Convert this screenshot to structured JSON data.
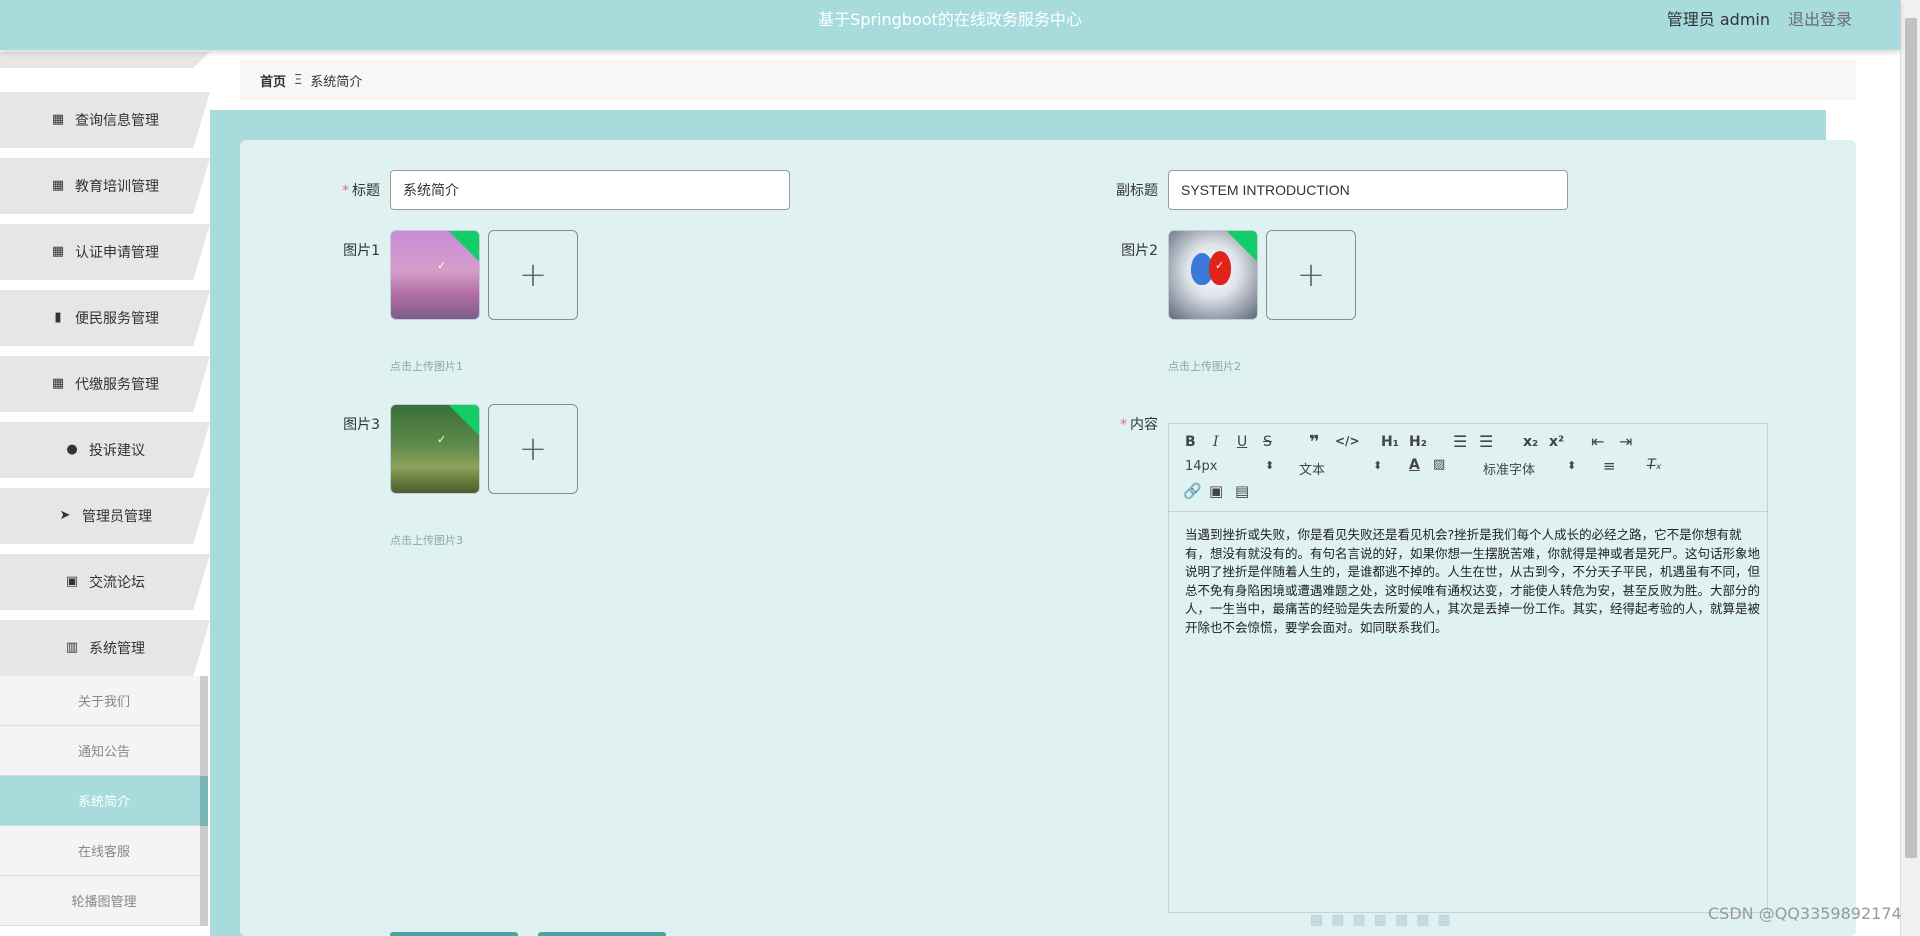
{
  "header": {
    "title": "基于Springboot的在线政务服务中心",
    "user_label": "管理员 admin",
    "logout_label": "退出登录"
  },
  "sidebar": {
    "items": [
      {
        "label": "查询信息管理",
        "icon": "grid-icon"
      },
      {
        "label": "教育培训管理",
        "icon": "grid-icon"
      },
      {
        "label": "认证申请管理",
        "icon": "grid-icon"
      },
      {
        "label": "便民服务管理",
        "icon": "bar-chart-icon"
      },
      {
        "label": "代缴服务管理",
        "icon": "grid-icon"
      },
      {
        "label": "投诉建议",
        "icon": "user-icon"
      },
      {
        "label": "管理员管理",
        "icon": "send-icon"
      },
      {
        "label": "交流论坛",
        "icon": "clipboard-icon"
      },
      {
        "label": "系统管理",
        "icon": "book-icon"
      }
    ],
    "sub_items": [
      {
        "label": "关于我们"
      },
      {
        "label": "通知公告"
      },
      {
        "label": "系统简介"
      },
      {
        "label": "在线客服"
      },
      {
        "label": "轮播图管理"
      }
    ]
  },
  "breadcrumb": {
    "home": "首页",
    "separator": "Ξ",
    "current": "系统简介"
  },
  "form": {
    "title_label": "标题",
    "title_value": "系统简介",
    "subtitle_label": "副标题",
    "subtitle_value": "SYSTEM INTRODUCTION",
    "image1_label": "图片1",
    "image1_hint": "点击上传图片1",
    "image2_label": "图片2",
    "image2_hint": "点击上传图片2",
    "image3_label": "图片3",
    "image3_hint": "点击上传图片3",
    "content_label": "内容",
    "upload_plus": "+"
  },
  "editor": {
    "font_size": "14px",
    "text_type": "文本",
    "font_family": "标准字体",
    "content": "当遇到挫折或失败，你是看见失败还是看见机会?挫折是我们每个人成长的必经之路，它不是你想有就有，想没有就没有的。有句名言说的好，如果你想一生摆脱苦难，你就得是神或者是死尸。这句话形象地说明了挫折是伴随着人生的，是谁都逃不掉的。人生在世，从古到今，不分天子平民，机遇虽有不同，但总不免有身陷困境或遭遇难题之处，这时候唯有通权达变，才能使人转危为安，甚至反败为胜。大部分的人，一生当中，最痛苦的经验是失去所爱的人，其次是丢掉一份工作。其实，经得起考验的人，就算是被开除也不会惊慌，要学会面对。如同联系我们。"
  },
  "watermark": "CSDN @QQ3359892174",
  "colors": {
    "header_bg": "#a8dcdc",
    "panel_bg": "#dff1f1",
    "active_menu": "#a8dcdc",
    "required": "#f56c6c",
    "upload_success": "#13ce66"
  }
}
